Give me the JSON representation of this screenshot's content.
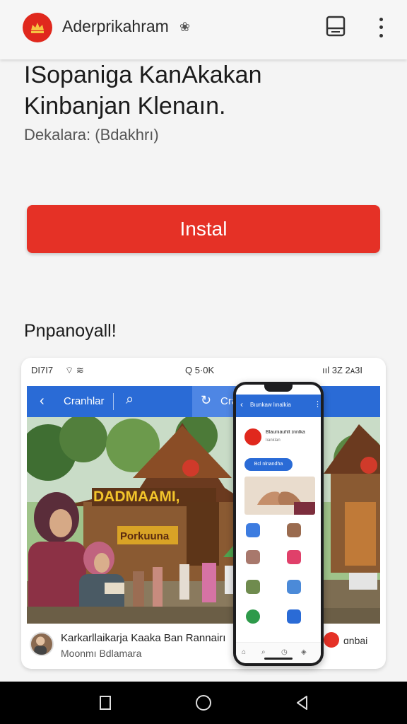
{
  "appbar": {
    "title": "Aderprikahram",
    "title_icon": "paw-icon",
    "colors": {
      "logo": "#e0281d"
    }
  },
  "app": {
    "name_line1": "ISopaniga KanAkakan",
    "name_line2": "Kinbanjan Klenaın.",
    "developer": "Dekalara: (Bdakhrı)"
  },
  "install": {
    "label": "Instal",
    "color": "#e53126"
  },
  "section": {
    "title": "Pnpanoyall!"
  },
  "screenshot": {
    "status_left": "DI7I7",
    "status_mid": "Q 5·0K",
    "status_right": "ııl 3Z 2ᴀ3I",
    "nav_label": "Cranhlar",
    "nav_chip_label": "Crac",
    "sign_main": "DADMAAMI,",
    "sign_sub": "Porkuuna",
    "caption_title": "Karkarllaikarja Kaaka Ban Rannairı",
    "caption_subtitle": "Moonmı Bdlamara",
    "caption_extra": "ɑnbai"
  },
  "phone": {
    "header": "Bıunkaw lınalkia",
    "app_name": "Blauniauhlt ɪnnlka",
    "app_sub": "lıanklan",
    "pill": "Bcl nlnandha"
  },
  "colors": {
    "accent_blue": "#2a6bd6",
    "accent_red": "#e53126",
    "background": "#f4f4f4"
  }
}
